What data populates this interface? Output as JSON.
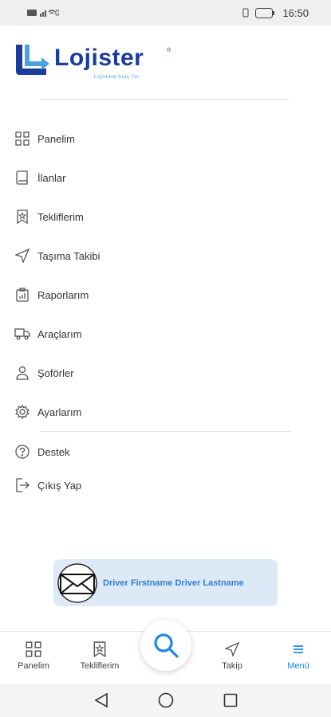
{
  "status_bar": {
    "time": "16:50",
    "battery": "80"
  },
  "logo": {
    "name": "Lojister",
    "tagline": "Lojistikte Araç Yol"
  },
  "menu": {
    "items": [
      {
        "label": "Panelim",
        "icon": "dashboard-grid-icon"
      },
      {
        "label": "İlanlar",
        "icon": "book-icon"
      },
      {
        "label": "Tekliflerim",
        "icon": "bookmark-star-icon"
      },
      {
        "label": "Taşıma Takibi",
        "icon": "navigation-arrow-icon"
      },
      {
        "label": "Raporlarım",
        "icon": "clipboard-chart-icon"
      },
      {
        "label": "Araçlarım",
        "icon": "truck-icon"
      },
      {
        "label": "Şoförler",
        "icon": "user-icon"
      },
      {
        "label": "Ayarlarım",
        "icon": "gear-icon"
      }
    ],
    "secondary": [
      {
        "label": "Destek",
        "icon": "help-circle-icon"
      },
      {
        "label": "Çıkış Yap",
        "icon": "logout-icon"
      }
    ]
  },
  "profile": {
    "name": "Driver Firstname Driver Lastname",
    "avatar_icon": "envelope-icon"
  },
  "bottom_nav": {
    "items": [
      {
        "label": "Panelim",
        "icon": "dashboard-grid-icon"
      },
      {
        "label": "Tekliflerim",
        "icon": "bookmark-star-icon"
      },
      {
        "label": "Takip",
        "icon": "navigation-arrow-icon"
      },
      {
        "label": "Menü",
        "icon": "menu-lines-icon",
        "active": true
      }
    ],
    "fab_icon": "search-icon"
  },
  "colors": {
    "brand": "#1a3d9c",
    "accent": "#1e88e5",
    "profile_bg": "#dde9f7"
  }
}
